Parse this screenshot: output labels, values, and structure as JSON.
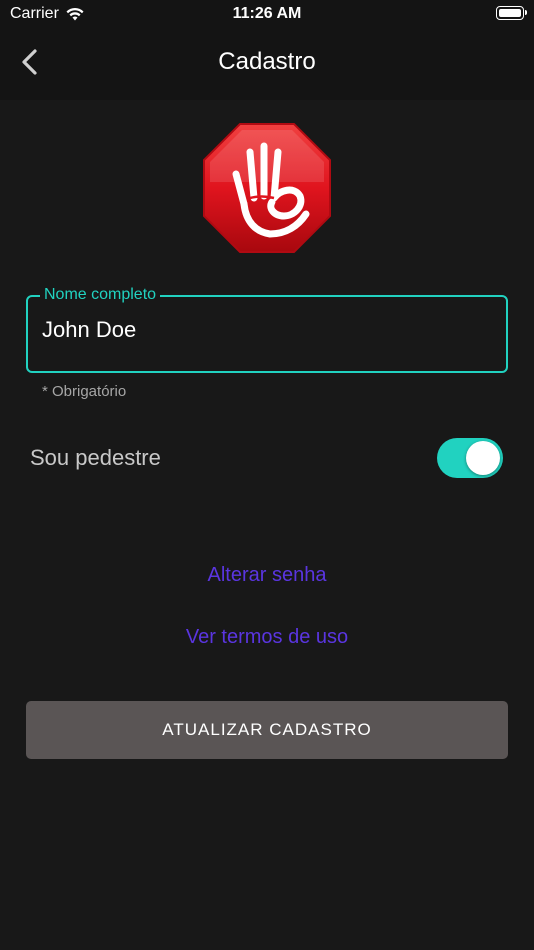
{
  "status_bar": {
    "carrier": "Carrier",
    "time": "11:26 AM"
  },
  "nav": {
    "title": "Cadastro"
  },
  "form": {
    "name_field": {
      "label": "Nome completo",
      "value": "John Doe"
    },
    "helper": "* Obrigatório",
    "pedestrian_toggle": {
      "label": "Sou pedestre",
      "checked": true
    }
  },
  "links": {
    "change_password": "Alterar senha",
    "terms": "Ver termos de uso"
  },
  "actions": {
    "update": "ATUALIZAR CADASTRO"
  },
  "colors": {
    "accent": "#21d2c0",
    "link": "#5a35e0",
    "logo_red": "#e0141e",
    "button": "#5a5555"
  }
}
